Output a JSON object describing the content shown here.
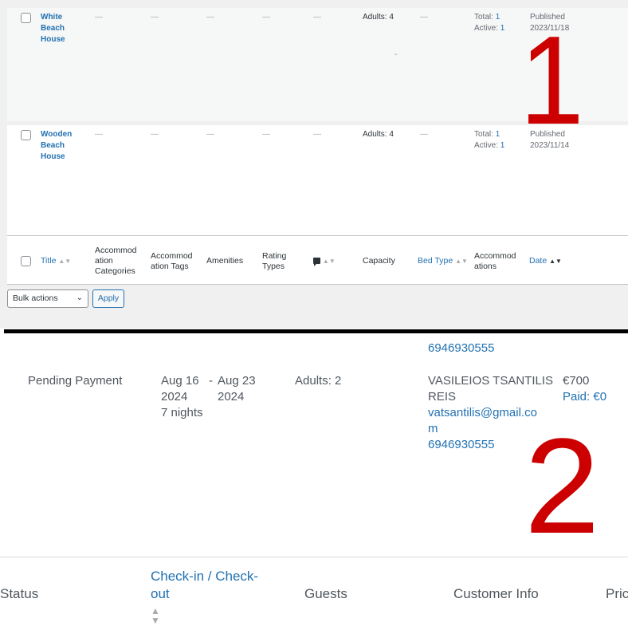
{
  "rows": [
    {
      "title": [
        "White",
        "Beach",
        "House"
      ],
      "categories": "—",
      "tags": "—",
      "amenities": "—",
      "rating": "—",
      "comments": "—",
      "capacity": "Adults: 4",
      "capacity_extra": "-",
      "bed_type": "—",
      "accommodations_total_label": "Total:",
      "accommodations_total": "1",
      "accommodations_active_label": "Active:",
      "accommodations_active": "1",
      "status": "Published",
      "date": "2023/11/18"
    },
    {
      "title": [
        "Wooden",
        "Beach",
        "House"
      ],
      "categories": "—",
      "tags": "—",
      "amenities": "—",
      "rating": "—",
      "comments": "—",
      "capacity": "Adults: 4",
      "bed_type": "—",
      "accommodations_total_label": "Total:",
      "accommodations_total": "1",
      "accommodations_active_label": "Active:",
      "accommodations_active": "1",
      "status": "Published",
      "date": "2023/11/14"
    }
  ],
  "columns": {
    "title": "Title",
    "categories": [
      "Accommod",
      "ation",
      "Categories"
    ],
    "tags": [
      "Accommod",
      "ation Tags"
    ],
    "amenities": "Amenities",
    "rating": [
      "Rating",
      "Types"
    ],
    "capacity": "Capacity",
    "bed_type": "Bed Type",
    "accommodations": [
      "Accommod",
      "ations"
    ],
    "date": "Date"
  },
  "bulk": {
    "select_label": "Bulk actions",
    "apply_label": "Apply"
  },
  "annotations": {
    "one": "1",
    "two": "2"
  },
  "booking": {
    "prev_phone": "6946930555",
    "status": "Pending Payment",
    "checkin": [
      "Aug 16",
      "2024"
    ],
    "separator": "-",
    "checkout": [
      "Aug 23",
      "2024"
    ],
    "nights": "7 nights",
    "guests": "Adults: 2",
    "customer_name": [
      "VASILEIOS TSANTILIS",
      "REIS"
    ],
    "customer_email": [
      "vatsantilis@gmail.co",
      "m"
    ],
    "customer_phone": "6946930555",
    "price": "€700",
    "paid": "Paid: €0"
  },
  "booking_columns": {
    "status": "Status",
    "checkin": [
      "Check-in / Check-",
      "out"
    ],
    "guests": "Guests",
    "customer": "Customer Info",
    "price": "Pric"
  }
}
